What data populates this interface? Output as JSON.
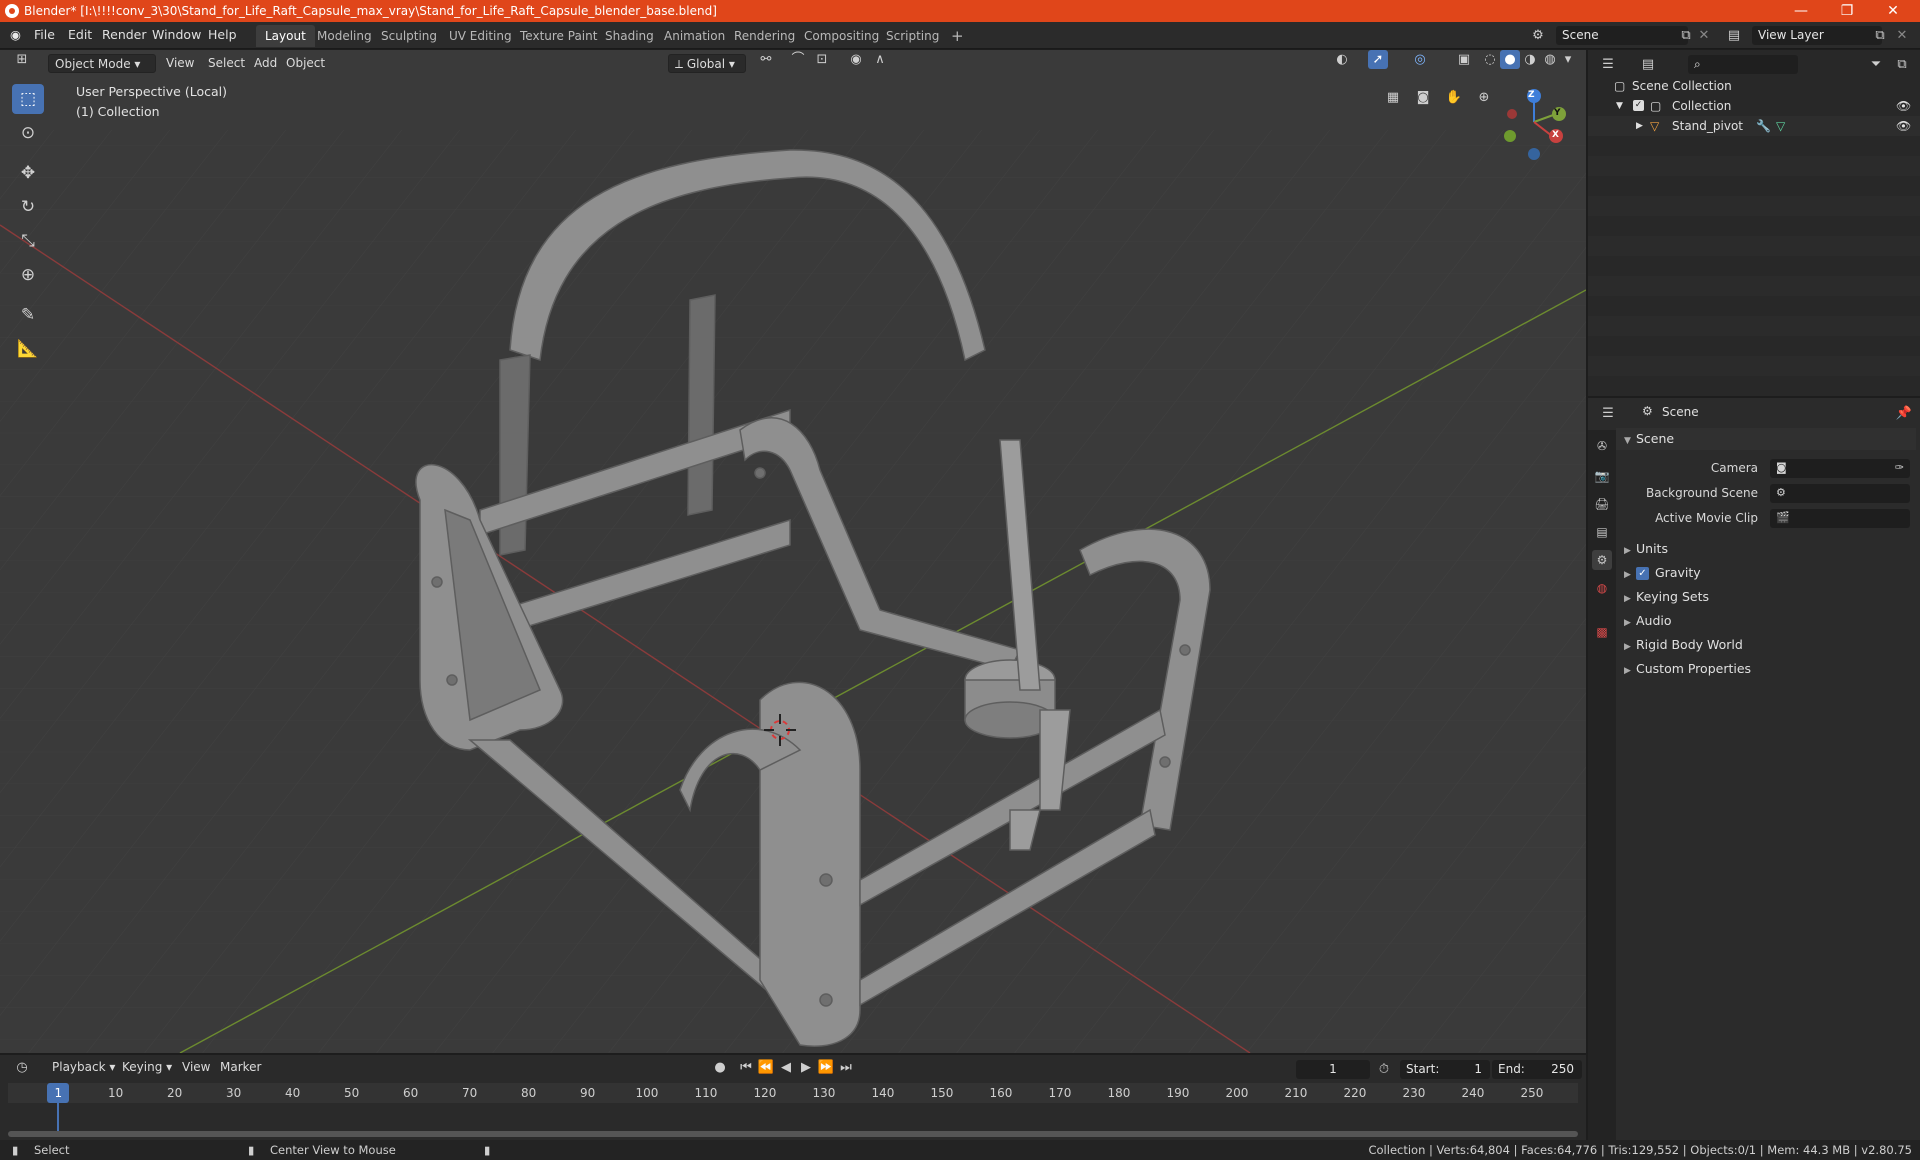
{
  "window": {
    "title": "Blender* [I:\\!!!!conv_3\\30\\Stand_for_Life_Raft_Capsule_max_vray\\Stand_for_Life_Raft_Capsule_blender_base.blend]",
    "minimize": "—",
    "restore": "❐",
    "close": "✕"
  },
  "menu": {
    "file": "File",
    "edit": "Edit",
    "render": "Render",
    "window": "Window",
    "help": "Help"
  },
  "workspaces": [
    "Layout",
    "Modeling",
    "Sculpting",
    "UV Editing",
    "Texture Paint",
    "Shading",
    "Animation",
    "Rendering",
    "Compositing",
    "Scripting"
  ],
  "workspace_add": "+",
  "scene_selector": "Scene",
  "view_layer": "View Layer",
  "viewport": {
    "mode": "Object Mode",
    "view": "View",
    "select": "Select",
    "add": "Add",
    "object": "Object",
    "orientation": "Global",
    "perspective_label": "User Perspective (Local)",
    "collection_label": "(1) Collection",
    "gizmo_axes": {
      "x": "X",
      "y": "Y",
      "z": "Z"
    }
  },
  "outliner": {
    "search_placeholder": "",
    "scene_collection": "Scene Collection",
    "collection": "Collection",
    "object": "Stand_pivot"
  },
  "properties": {
    "context": "Scene",
    "panel": "Scene",
    "camera_label": "Camera",
    "background_scene_label": "Background Scene",
    "active_movie_clip_label": "Active Movie Clip",
    "panels": [
      "Units",
      "Gravity",
      "Keying Sets",
      "Audio",
      "Rigid Body World",
      "Custom Properties"
    ],
    "gravity_checked": true
  },
  "timeline": {
    "playback": "Playback",
    "keying": "Keying",
    "view": "View",
    "marker": "Marker",
    "current_frame": "1",
    "start_label": "Start:",
    "start": "1",
    "end_label": "End:",
    "end": "250",
    "ticks": [
      "1",
      "10",
      "20",
      "30",
      "40",
      "50",
      "60",
      "70",
      "80",
      "90",
      "100",
      "110",
      "120",
      "130",
      "140",
      "150",
      "160",
      "170",
      "180",
      "190",
      "200",
      "210",
      "220",
      "230",
      "240",
      "250"
    ]
  },
  "status": {
    "select": "Select",
    "center_view": "Center View to Mouse",
    "stats": "Collection | Verts:64,804 | Faces:64,776 | Tris:129,552 | Objects:0/1 | Mem: 44.3 MB | v2.80.75"
  },
  "colors": {
    "titlebar": "#e0461a",
    "accent": "#4772b3",
    "x_axis": "#c8413f",
    "y_axis": "#7ea13a",
    "z_axis": "#3e7ed9"
  }
}
